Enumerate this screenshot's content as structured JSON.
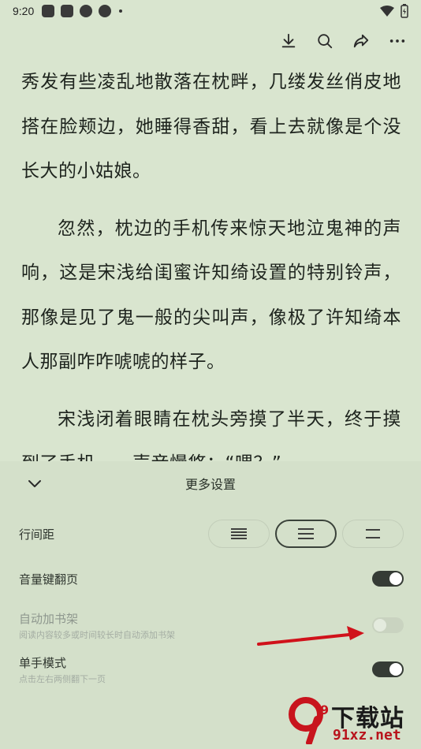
{
  "status_bar": {
    "time": "9:20"
  },
  "reader": {
    "paragraphs": [
      "秀发有些凌乱地散落在枕畔，几缕发丝俏皮地搭在脸颊边，她睡得香甜，看上去就像是个没长大的小姑娘。",
      "忽然，枕边的手机传来惊天地泣鬼神的声响，这是宋浅给闺蜜许知绮设置的特别铃声，那像是见了鬼一般的尖叫声，像极了许知绮本人那副咋咋唬唬的样子。",
      "宋浅闭着眼睛在枕头旁摸了半天，终于摸到了手机，一声音慢悠：“喂？”"
    ]
  },
  "panel": {
    "title": "更多设置",
    "line_spacing": {
      "label": "行间距",
      "selected_index": 1
    },
    "volume_key_page": {
      "label": "音量键翻页",
      "enabled": true
    },
    "auto_shelf": {
      "label": "自动加书架",
      "sub": "阅读内容较多或时间较长时自动添加书架",
      "enabled": false
    },
    "one_hand": {
      "label": "单手模式",
      "sub": "点击左右两侧翻下一页",
      "enabled": true
    }
  },
  "watermark": {
    "brand": "下载站",
    "url": "91xz.net",
    "logo": "9"
  },
  "colors": {
    "background": "#d9e5cf",
    "panel": "#d4e0ca",
    "toggle_on": "#353b35",
    "arrow": "#d0121b"
  }
}
